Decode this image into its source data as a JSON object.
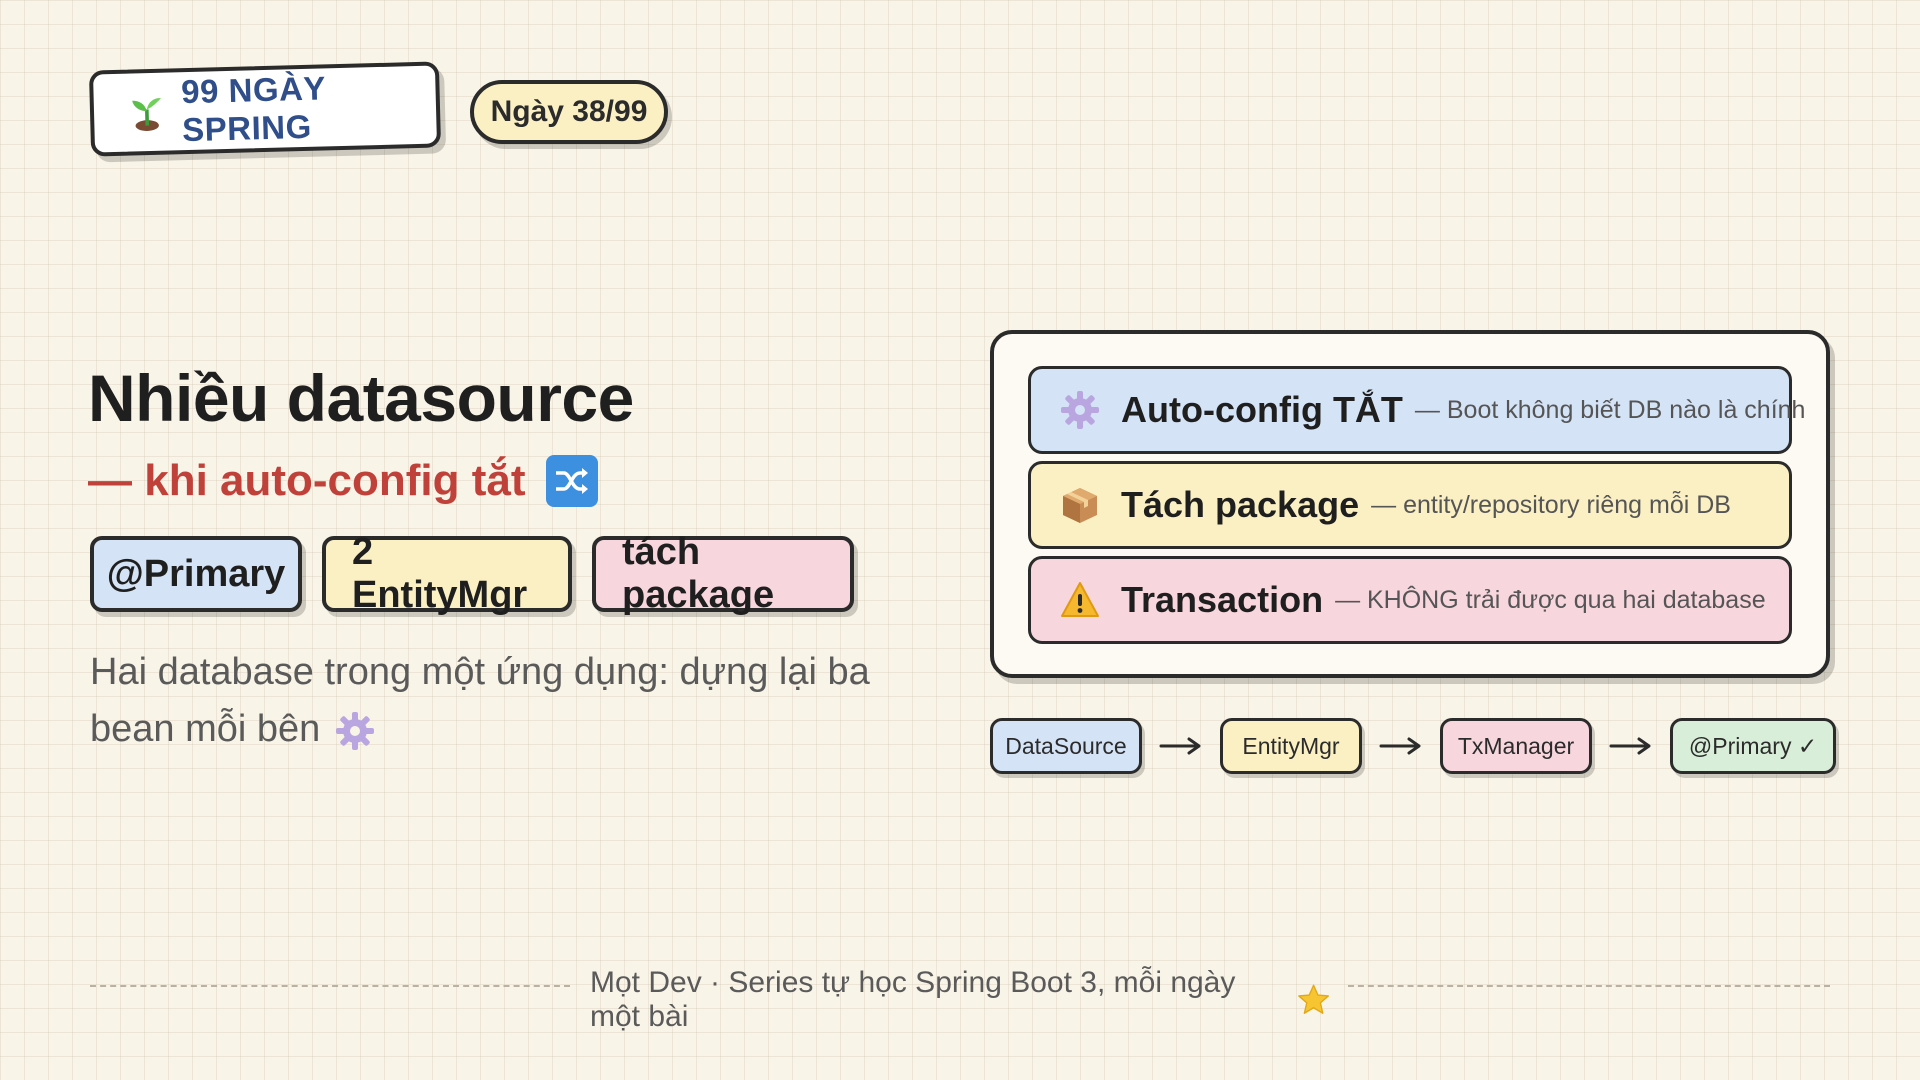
{
  "header": {
    "series_label": "99 NGÀY SPRING",
    "day_label": "Ngày 38/99"
  },
  "main": {
    "title": "Nhiều datasource",
    "subtitle": "— khi auto-config tắt",
    "tags": [
      "@Primary",
      "2 EntityMgr",
      "tách package"
    ],
    "description": "Hai database trong một ứng dụng: dựng lại ba bean mỗi bên"
  },
  "card": {
    "rows": [
      {
        "icon": "gear-icon",
        "title": "Auto-config TẮT",
        "desc": "— Boot không biết DB nào là chính",
        "color": "#d5e3f7"
      },
      {
        "icon": "package-icon",
        "title": "Tách package",
        "desc": "— entity/repository riêng mỗi DB",
        "color": "#fbf0c4"
      },
      {
        "icon": "warning-icon",
        "title": "Transaction",
        "desc": "— KHÔNG trải được qua hai database",
        "color": "#f8d6dd"
      }
    ]
  },
  "flow": {
    "nodes": [
      "DataSource",
      "EntityMgr",
      "TxManager",
      "@Primary ✓"
    ]
  },
  "footer": {
    "text": "Mọt Dev · Series tự học Spring Boot 3, mỗi ngày một bài"
  }
}
